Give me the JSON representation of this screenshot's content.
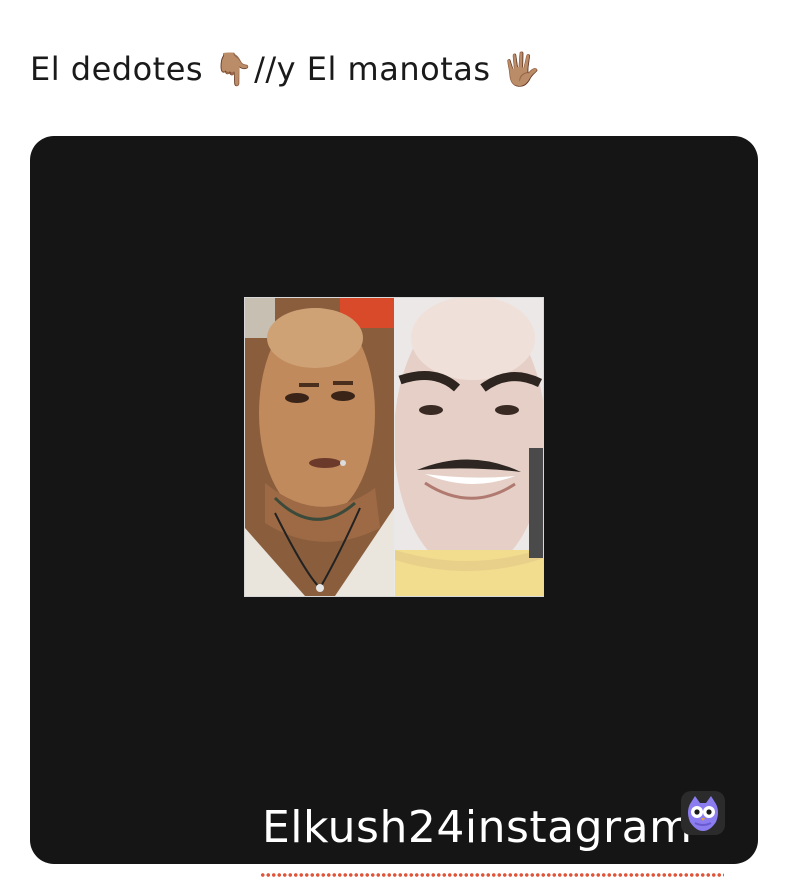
{
  "post": {
    "caption": "El dedotes 👇🏽//y El manotas 🖐🏽"
  },
  "image": {
    "background_color": "#151515",
    "watermark": "Elkush24instagram",
    "thumbnail_icons": [
      "bald-man-face-image",
      "older-man-mustache-face-image"
    ]
  },
  "brand": {
    "icon": "owl-icon",
    "accent_dots_color": "#e0553a"
  }
}
